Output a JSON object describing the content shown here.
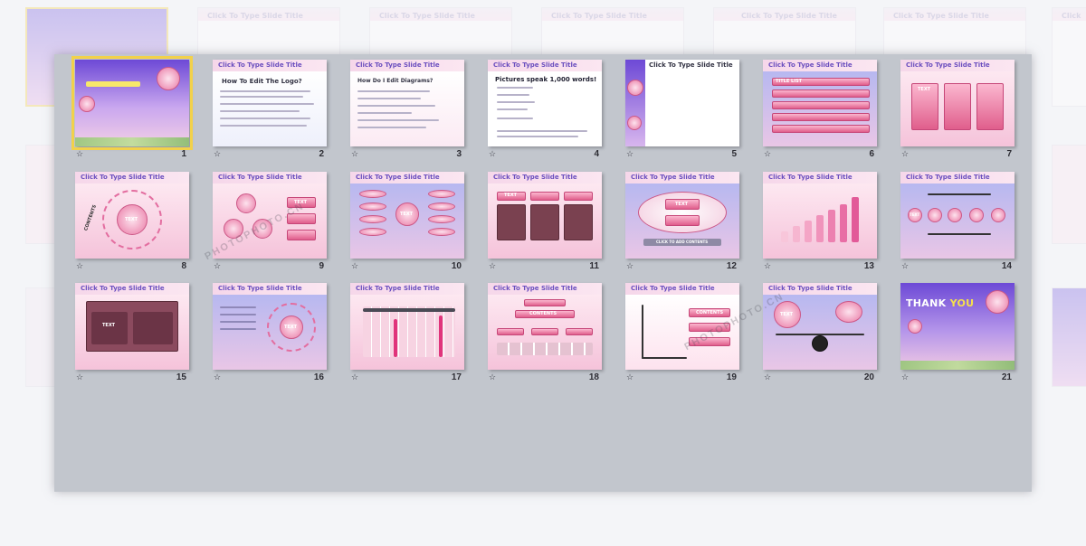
{
  "background_thumbs": [
    {
      "title": ""
    },
    {
      "title": "Click To Type Slide Title"
    },
    {
      "title": "Click To Type Slide Title"
    },
    {
      "title": "Click To Type Slide Title"
    },
    {
      "title": "Click To Type Slide Title"
    },
    {
      "title": "Click To Type Slide Title"
    },
    {
      "title": "Click"
    }
  ],
  "slides": [
    {
      "number": "1",
      "title": "",
      "style": "cover"
    },
    {
      "number": "2",
      "title": "Click To Type Slide Title",
      "heading": "How To Edit The Logo?",
      "style": "text"
    },
    {
      "number": "3",
      "title": "Click To Type Slide Title",
      "heading": "How Do I Edit Diagrams?",
      "style": "text"
    },
    {
      "number": "4",
      "title": "Click To Type Slide Title",
      "heading": "Pictures speak 1,000 words!",
      "style": "white"
    },
    {
      "number": "5",
      "title": "Click To Type Slide Title",
      "style": "white-side"
    },
    {
      "number": "6",
      "title": "Click To Type Slide Title",
      "list_label": "TITLE LIST",
      "style": "list"
    },
    {
      "number": "7",
      "title": "Click To Type Slide Title",
      "box_label": "TEXT",
      "style": "columns"
    },
    {
      "number": "8",
      "title": "Click To Type Slide Title",
      "center_label": "TEXT",
      "side_label": "CONTENTS",
      "style": "circle"
    },
    {
      "number": "9",
      "title": "Click To Type Slide Title",
      "box_label": "TEXT",
      "style": "cycle"
    },
    {
      "number": "10",
      "title": "Click To Type Slide Title",
      "center_label": "TEXT",
      "style": "ovals"
    },
    {
      "number": "11",
      "title": "Click To Type Slide Title",
      "box_label": "TEXT",
      "style": "table"
    },
    {
      "number": "12",
      "title": "Click To Type Slide Title",
      "box_label": "TEXT",
      "footer": "CLICK TO ADD CONTENTS",
      "style": "diamond"
    },
    {
      "number": "13",
      "title": "Click To Type Slide Title",
      "style": "bars"
    },
    {
      "number": "14",
      "title": "Click To Type Slide Title",
      "box_label": "TEXT",
      "style": "flow"
    },
    {
      "number": "15",
      "title": "Click To Type Slide Title",
      "box_label": "TEXT",
      "style": "frame"
    },
    {
      "number": "16",
      "title": "Click To Type Slide Title",
      "center_label": "TEXT",
      "style": "petals"
    },
    {
      "number": "17",
      "title": "Click To Type Slide Title",
      "style": "spikes"
    },
    {
      "number": "18",
      "title": "Click To Type Slide Title",
      "box_label": "CONTENTS",
      "style": "org"
    },
    {
      "number": "19",
      "title": "Click To Type Slide Title",
      "box_label": "CONTENTS",
      "style": "steps"
    },
    {
      "number": "20",
      "title": "Click To Type Slide Title",
      "box_label": "TEXT",
      "style": "scale"
    },
    {
      "number": "21",
      "title": "",
      "thanks_a": "THANK ",
      "thanks_b": "YOU",
      "style": "thanks"
    }
  ],
  "watermarks": [
    "PHOTOPHOTO.CN",
    "PHOTOPHOTO.CN",
    "PHOTOPHOTO.CN"
  ],
  "colors": {
    "panel": "#c2c6cd",
    "selection": "#f2d14a",
    "title_text": "#6b4fbf",
    "accent_pink": "#e05e8c",
    "cover_purple": "#6d49d6"
  },
  "icons": {
    "slide_marker": "star-icon"
  }
}
